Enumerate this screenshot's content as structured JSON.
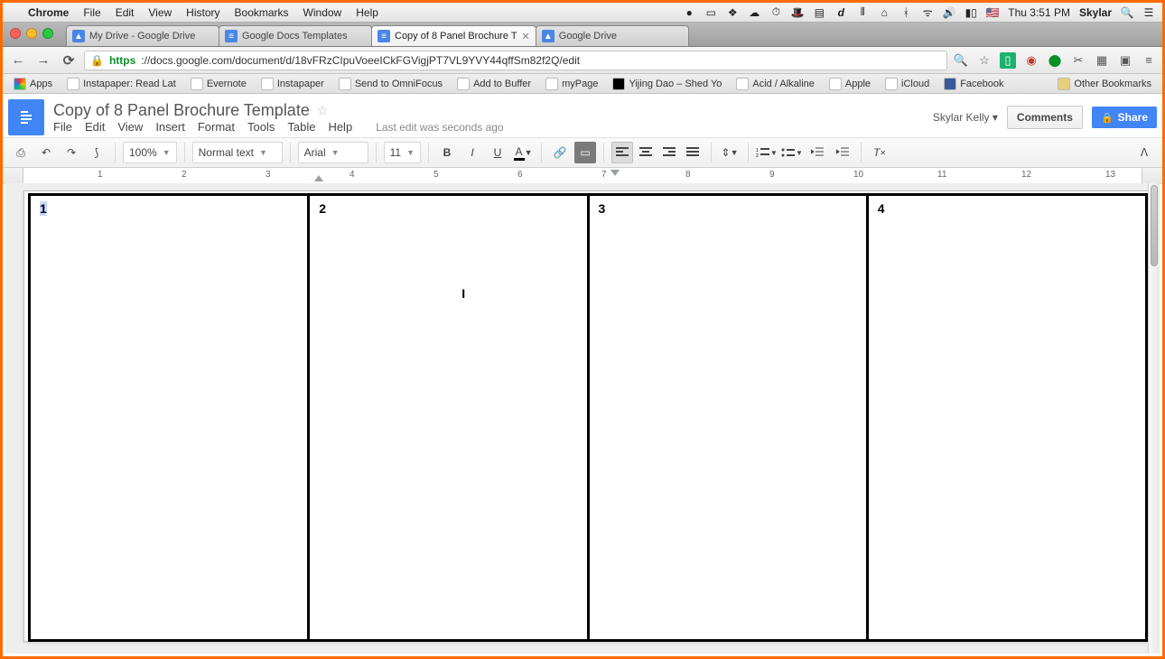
{
  "mac_menu": {
    "app": "Chrome",
    "items": [
      "File",
      "Edit",
      "View",
      "History",
      "Bookmarks",
      "Window",
      "Help"
    ],
    "clock": "Thu 3:51 PM",
    "user": "Skylar"
  },
  "tabs": [
    {
      "title": "My Drive - Google Drive"
    },
    {
      "title": "Google Docs Templates"
    },
    {
      "title": "Copy of 8 Panel Brochure T"
    },
    {
      "title": "Google Drive"
    }
  ],
  "active_tab_index": 2,
  "address": {
    "scheme": "https",
    "rest": "://docs.google.com/document/d/18vFRzCIpuVoeeICkFGVigjPT7VL9YVY44qffSm82f2Q/edit"
  },
  "bookmarks": {
    "apps_label": "Apps",
    "items": [
      "Instapaper: Read Lat",
      "Evernote",
      "Instapaper",
      "Send to OmniFocus",
      "Add to Buffer",
      "myPage",
      "Yijing Dao – Shed Yo",
      "Acid / Alkaline",
      "Apple",
      "iCloud",
      "Facebook"
    ],
    "other": "Other Bookmarks"
  },
  "docs": {
    "title": "Copy of 8 Panel Brochure Template",
    "menus": [
      "File",
      "Edit",
      "View",
      "Insert",
      "Format",
      "Tools",
      "Table",
      "Help"
    ],
    "lastedit": "Last edit was seconds ago",
    "user": "Skylar Kelly",
    "comments_label": "Comments",
    "share_label": "Share"
  },
  "toolbar": {
    "zoom": "100%",
    "styles": "Normal text",
    "font": "Arial",
    "size": "11"
  },
  "ruler_numbers": [
    "1",
    "2",
    "3",
    "4",
    "5",
    "6",
    "7",
    "8",
    "9",
    "10",
    "11",
    "12",
    "13"
  ],
  "panels": [
    "1",
    "2",
    "3",
    "4"
  ]
}
